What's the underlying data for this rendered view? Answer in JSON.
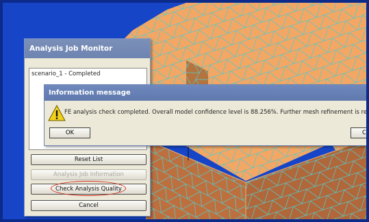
{
  "analysis_job_monitor": {
    "title": "Analysis Job Monitor",
    "jobs": [
      {
        "label": "scenario_1 - Completed"
      }
    ],
    "buttons": {
      "reset_list": "Reset List",
      "analysis_job_information": "Analysis Job Information",
      "check_analysis_quality": "Check Analysis Quality",
      "cancel": "Cancel"
    }
  },
  "information_message": {
    "title": "Information message",
    "text": "FE analysis check completed.  Overall model confidence level is  88.256%.  Further mesh refinement is recommen",
    "ok_label": "OK",
    "cancel_label": "Canc"
  },
  "colors": {
    "background_blue": "#1645c8",
    "model_face_top": "#f3a765",
    "model_face_side": "#b86b3a",
    "mesh_lines": "#53c7c9",
    "highlight_red": "#d12a1a"
  }
}
